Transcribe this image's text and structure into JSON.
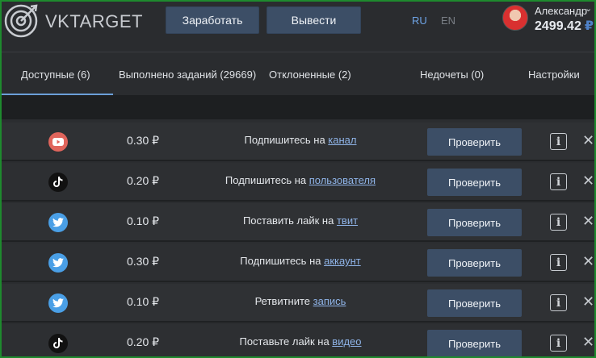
{
  "header": {
    "logo_text": "VKTARGET",
    "earn_label": "Заработать",
    "withdraw_label": "Вывести",
    "lang_ru": "RU",
    "lang_en": "EN",
    "user_name": "Александр",
    "balance": "2499.42",
    "currency": "₽"
  },
  "tabs": [
    {
      "label": "Доступные (6)",
      "active": true
    },
    {
      "label": "Выполнено заданий (29669)"
    },
    {
      "label": "Отклоненные (2)"
    },
    {
      "label": "Недочеты (0)"
    },
    {
      "label": "Настройки"
    }
  ],
  "tasks": [
    {
      "network": "youtube-icon",
      "price": "0.30 ₽",
      "text": "Подпишитесь на ",
      "link": "канал",
      "button": "Проверить"
    },
    {
      "network": "tiktok-icon",
      "price": "0.20 ₽",
      "text": "Подпишитесь на ",
      "link": "пользователя",
      "button": "Проверить"
    },
    {
      "network": "twitter-icon",
      "price": "0.10 ₽",
      "text": "Поставить лайк на ",
      "link": "твит",
      "button": "Проверить"
    },
    {
      "network": "twitter-icon",
      "price": "0.30 ₽",
      "text": "Подпишитесь на ",
      "link": "аккаунт",
      "button": "Проверить"
    },
    {
      "network": "twitter-icon",
      "price": "0.10 ₽",
      "text": "Ретвитните ",
      "link": "запись",
      "button": "Проверить"
    },
    {
      "network": "tiktok-icon",
      "price": "0.20 ₽",
      "text": "Поставьте лайк на ",
      "link": "видео",
      "button": "Проверить"
    }
  ],
  "colors": {
    "accent": "#6b9fd8",
    "button": "#3c4e66",
    "youtube": "#e0655c",
    "twitter": "#4a9fe6",
    "tiktok": "#111111"
  }
}
